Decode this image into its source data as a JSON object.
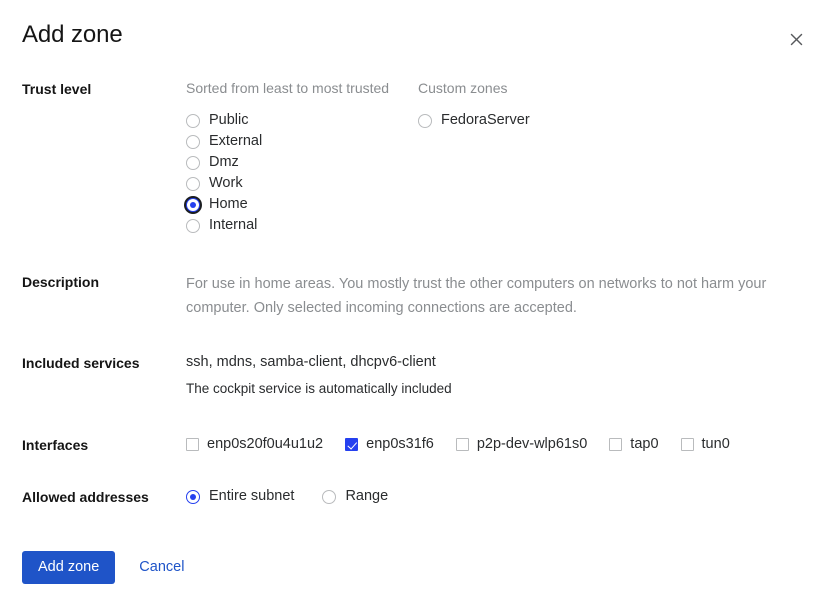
{
  "dialog": {
    "title": "Add zone",
    "close_icon": "close-icon"
  },
  "trust_level": {
    "label": "Trust level",
    "sorted_heading": "Sorted from least to most trusted",
    "custom_heading": "Custom zones",
    "zones": [
      {
        "label": "Public",
        "checked": false,
        "focused": false
      },
      {
        "label": "External",
        "checked": false,
        "focused": false
      },
      {
        "label": "Dmz",
        "checked": false,
        "focused": false
      },
      {
        "label": "Work",
        "checked": false,
        "focused": false
      },
      {
        "label": "Home",
        "checked": true,
        "focused": true
      },
      {
        "label": "Internal",
        "checked": false,
        "focused": false
      }
    ],
    "custom_zones": [
      {
        "label": "FedoraServer",
        "checked": false,
        "focused": false
      }
    ]
  },
  "description": {
    "label": "Description",
    "text": "For use in home areas. You mostly trust the other computers on networks to not harm your computer. Only selected incoming connections are accepted."
  },
  "included_services": {
    "label": "Included services",
    "services": "ssh, mdns, samba-client, dhcpv6-client",
    "note": "The cockpit service is automatically included"
  },
  "interfaces": {
    "label": "Interfaces",
    "items": [
      {
        "label": "enp0s20f0u4u1u2",
        "checked": false
      },
      {
        "label": "enp0s31f6",
        "checked": true
      },
      {
        "label": "p2p-dev-wlp61s0",
        "checked": false
      },
      {
        "label": "tap0",
        "checked": false
      },
      {
        "label": "tun0",
        "checked": false
      }
    ]
  },
  "allowed_addresses": {
    "label": "Allowed addresses",
    "options": [
      {
        "label": "Entire subnet",
        "checked": true,
        "focused": false
      },
      {
        "label": "Range",
        "checked": false,
        "focused": false
      }
    ]
  },
  "footer": {
    "submit_label": "Add zone",
    "cancel_label": "Cancel"
  },
  "colors": {
    "accent": "#2540ef",
    "button_blue": "#1f54c8",
    "muted_text": "#8a8d90",
    "body_text": "#2a2c2e"
  }
}
